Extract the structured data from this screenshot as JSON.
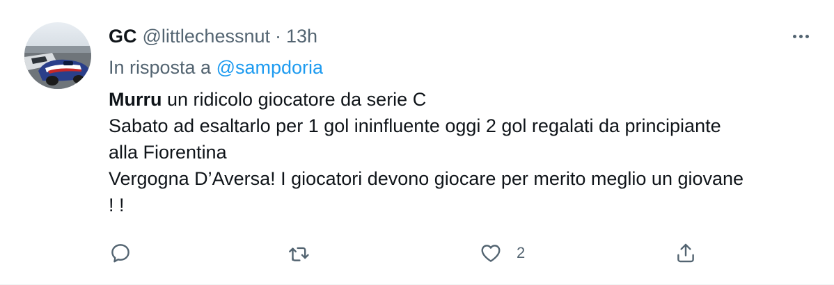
{
  "tweet": {
    "author_name": "GC",
    "author_handle": "@littlechessnut",
    "separator": "·",
    "time": "13h",
    "reply_prefix": "In risposta a",
    "reply_mention": "@sampdoria",
    "body_bold": "Murru",
    "body_line1_rest": " un ridicolo giocatore da serie C",
    "body_line2": "Sabato ad esaltarlo per 1 gol ininfluente oggi 2 gol regalati da principiante",
    "body_line3": "alla Fiorentina",
    "body_line4": "Vergogna D’Aversa! I giocatori devono giocare per merito meglio un giovane",
    "body_line5": "! !"
  },
  "actions": {
    "reply_icon": "reply-icon",
    "retweet_icon": "retweet-icon",
    "like_icon": "heart-icon",
    "like_count": "2",
    "share_icon": "share-icon"
  },
  "colors": {
    "text": "#0f1419",
    "secondary": "#536471",
    "accent": "#1d9bf0"
  }
}
